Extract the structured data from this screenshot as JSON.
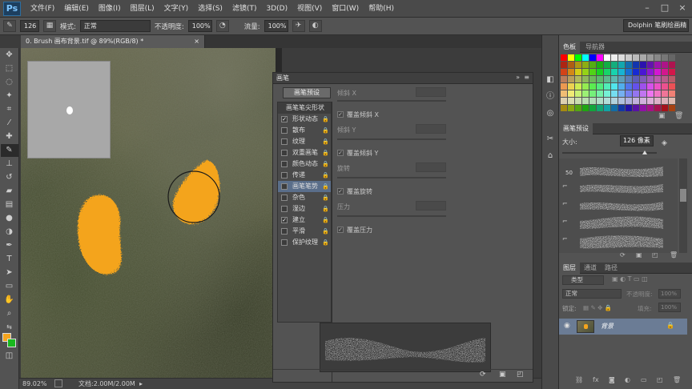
{
  "menubar": {
    "logo": "Ps",
    "items": [
      "文件(F)",
      "编辑(E)",
      "图像(I)",
      "图层(L)",
      "文字(Y)",
      "选择(S)",
      "滤镜(T)",
      "3D(D)",
      "视图(V)",
      "窗口(W)",
      "帮助(H)"
    ],
    "window_controls": [
      "–",
      "□",
      "×"
    ]
  },
  "optbar": {
    "brush_size": "126",
    "mode_label": "模式:",
    "mode_value": "正常",
    "opacity_label": "不透明度:",
    "opacity_value": "100%",
    "flow_label": "流量:",
    "flow_value": "100%",
    "workspace": "Dolphin 笔刷绘画精"
  },
  "document": {
    "tab_title": "0. Brush 画布背景.tif @ 89%(RGB/8) *",
    "tab_close": "×"
  },
  "status": {
    "zoom": "89.02%",
    "doc_info": "文档:2.00M/2.00M"
  },
  "brush_panel": {
    "title": "画笔",
    "presets_button": "画笔预设",
    "list_header": "画笔笔尖形状",
    "items": [
      {
        "label": "形状动态",
        "checked": true,
        "selected": false
      },
      {
        "label": "散布",
        "checked": false,
        "selected": false
      },
      {
        "label": "纹理",
        "checked": false,
        "selected": false
      },
      {
        "label": "双重画笔",
        "checked": false,
        "selected": false
      },
      {
        "label": "颜色动态",
        "checked": false,
        "selected": false
      },
      {
        "label": "传递",
        "checked": false,
        "selected": false
      },
      {
        "label": "画笔笔势",
        "checked": false,
        "selected": true
      },
      {
        "label": "杂色",
        "checked": false,
        "selected": false
      },
      {
        "label": "湿边",
        "checked": false,
        "selected": false
      },
      {
        "label": "建立",
        "checked": true,
        "selected": false
      },
      {
        "label": "平滑",
        "checked": false,
        "selected": false
      },
      {
        "label": "保护纹理",
        "checked": false,
        "selected": false
      }
    ],
    "check_mark": "✓",
    "lock_glyph": "🔒",
    "settings": {
      "tilt_x": "倾斜 X",
      "override_tilt_x": "覆盖倾斜 X",
      "tilt_y": "倾斜 Y",
      "override_tilt_y": "覆盖倾斜 Y",
      "rotation": "旋转",
      "override_rotation": "覆盖旋转",
      "pressure": "压力",
      "override_pressure": "覆盖压力"
    }
  },
  "right_panels": {
    "color_tabs": [
      "色板",
      "导航器"
    ],
    "brush_presets_tab": "画笔预设",
    "size_label": "大小:",
    "size_value": "126 像素",
    "preset_number": "50",
    "layers_tabs": [
      "图层",
      "通道",
      "路径"
    ],
    "kind_label": "类型",
    "blend_mode": "正常",
    "opacity_label": "不透明度:",
    "opacity_value": "100%",
    "lock_label": "锁定:",
    "fill_label": "填充:",
    "fill_value": "100%",
    "layer_name": "背景"
  },
  "colors": {
    "paint": "#f4a41e",
    "swatches": [
      "#ff0000",
      "#ffff00",
      "#00ff00",
      "#00ffff",
      "#0000ff",
      "#ff00ff",
      "#ffffff",
      "#eeeeee",
      "#dddddd",
      "#cccccc",
      "#bbbbbb",
      "#aaaaaa",
      "#999999",
      "#888888",
      "#777777",
      "#666666",
      "#555555",
      "#ff6666"
    ]
  }
}
